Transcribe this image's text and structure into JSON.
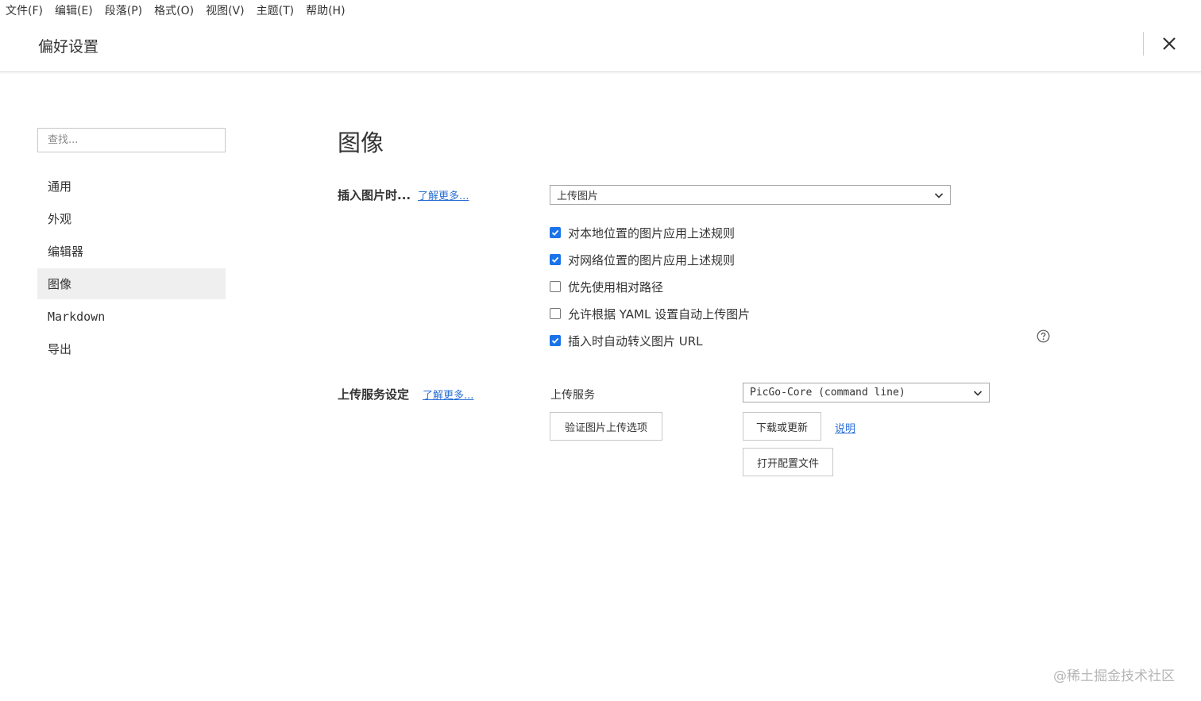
{
  "menubar": {
    "items": [
      "文件(F)",
      "编辑(E)",
      "段落(P)",
      "格式(O)",
      "视图(V)",
      "主题(T)",
      "帮助(H)"
    ]
  },
  "header": {
    "title": "偏好设置",
    "close_icon": "close-icon"
  },
  "sidebar": {
    "search_placeholder": "查找...",
    "items": [
      {
        "label": "通用"
      },
      {
        "label": "外观"
      },
      {
        "label": "编辑器"
      },
      {
        "label": "图像",
        "active": true
      },
      {
        "label": "Markdown"
      },
      {
        "label": "导出"
      }
    ]
  },
  "main": {
    "title": "图像",
    "insert_section": {
      "label": "插入图片时...",
      "learn_more": "了解更多...",
      "select_value": "上传图片",
      "options": [
        {
          "label": "对本地位置的图片应用上述规则",
          "checked": true
        },
        {
          "label": "对网络位置的图片应用上述规则",
          "checked": true
        },
        {
          "label": "优先使用相对路径",
          "checked": false
        },
        {
          "label": "允许根据 YAML 设置自动上传图片",
          "checked": false
        },
        {
          "label": "插入时自动转义图片 URL",
          "checked": true
        }
      ],
      "help_icon": "question-circle-icon"
    },
    "upload_section": {
      "label": "上传服务设定",
      "learn_more": "了解更多...",
      "service_label": "上传服务",
      "service_value": "PicGo-Core (command line)",
      "verify_button": "验证图片上传选项",
      "download_button": "下载或更新",
      "explain_link": "说明",
      "open_config_button": "打开配置文件"
    }
  },
  "watermark": "@稀土掘金技术社区",
  "colors": {
    "accent": "#1a73e8",
    "link": "#2a6fd6",
    "active_bg": "#efefef"
  }
}
